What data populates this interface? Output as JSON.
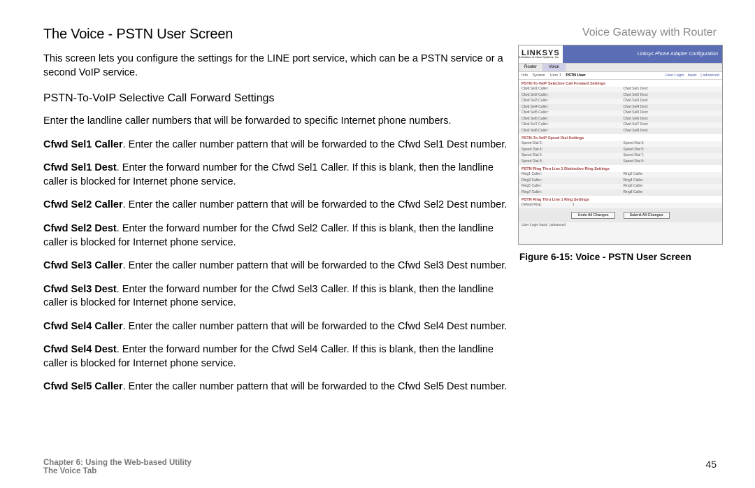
{
  "header": {
    "product": "Voice Gateway with Router"
  },
  "title": "The Voice - PSTN User Screen",
  "intro": "This screen lets you configure the settings for the LINE port service, which can be a PSTN service or a second VoIP service.",
  "subhead": "PSTN-To-VoIP Selective Call Forward Settings",
  "p_intro2": "Enter the landline caller numbers that will be forwarded to specific Internet phone numbers.",
  "paras": [
    {
      "b": "Cfwd Sel1 Caller",
      "t": ". Enter the caller number pattern that will be forwarded to the Cfwd Sel1 Dest number."
    },
    {
      "b": "Cfwd Sel1 Dest",
      "t": ". Enter the forward number for the Cfwd Sel1 Caller. If this is blank, then the landline caller is blocked for Internet phone service."
    },
    {
      "b": "Cfwd Sel2 Caller",
      "t": ". Enter the caller number pattern that will be forwarded to the Cfwd Sel2 Dest number."
    },
    {
      "b": "Cfwd Sel2 Dest",
      "t": ". Enter the forward number for the Cfwd Sel2 Caller. If this is blank, then the landline caller is blocked for Internet phone service."
    },
    {
      "b": "Cfwd Sel3 Caller",
      "t": ". Enter the caller number pattern that will be forwarded to the Cfwd Sel3 Dest number."
    },
    {
      "b": "Cfwd Sel3 Dest",
      "t": ". Enter the forward number for the Cfwd Sel3 Caller. If this is blank, then the landline caller is blocked for Internet phone service."
    },
    {
      "b": "Cfwd Sel4 Caller",
      "t": ". Enter the caller number pattern that will be forwarded to the Cfwd Sel4 Dest number."
    },
    {
      "b": "Cfwd Sel4 Dest",
      "t": ". Enter the forward number for the Cfwd Sel4 Caller. If this is blank, then the landline caller is blocked for Internet phone service."
    },
    {
      "b": "Cfwd Sel5 Caller",
      "t": ". Enter the caller number pattern that will be forwarded to the Cfwd Sel5 Dest number."
    }
  ],
  "figure": {
    "logo": "LINKSYS",
    "logo_sub": "A Division of Cisco Systems, Inc.",
    "banner": "Linksys Phone Adapter Configuration",
    "tabs1": [
      "Router",
      "Voice"
    ],
    "tabs2_left": [
      "Info",
      "System",
      "User 1",
      "PSTN User"
    ],
    "tabs2_right": [
      "User Login",
      "basic",
      "| advanced"
    ],
    "sec1_head": "PSTN-To-VoIP Selective Call Forward Settings",
    "sec1_rows": [
      [
        "Cfwd Sel1 Caller:",
        "",
        "Cfwd Sel1 Dest:",
        ""
      ],
      [
        "Cfwd Sel2 Caller:",
        "",
        "Cfwd Sel2 Dest:",
        ""
      ],
      [
        "Cfwd Sel3 Caller:",
        "",
        "Cfwd Sel3 Dest:",
        ""
      ],
      [
        "Cfwd Sel4 Caller:",
        "",
        "Cfwd Sel4 Dest:",
        ""
      ],
      [
        "Cfwd Sel5 Caller:",
        "",
        "Cfwd Sel5 Dest:",
        ""
      ],
      [
        "Cfwd Sel6 Caller:",
        "",
        "Cfwd Sel6 Dest:",
        ""
      ],
      [
        "Cfwd Sel7 Caller:",
        "",
        "Cfwd Sel7 Dest:",
        ""
      ],
      [
        "Cfwd Sel8 Caller:",
        "",
        "Cfwd Sel8 Dest:",
        ""
      ]
    ],
    "sec2_head": "PSTN-To-VoIP Speed Dial Settings",
    "sec2_rows": [
      [
        "Speed Dial 2:",
        "",
        "Speed Dial 3:",
        ""
      ],
      [
        "Speed Dial 4:",
        "",
        "Speed Dial 5:",
        ""
      ],
      [
        "Speed Dial 6:",
        "",
        "Speed Dial 7:",
        ""
      ],
      [
        "Speed Dial 8:",
        "",
        "Speed Dial 9:",
        ""
      ]
    ],
    "sec3_head": "PSTN Ring Thru Line 1 Distinctive Ring Settings",
    "sec3_rows": [
      [
        "Ring1 Caller:",
        "",
        "Ring2 Caller:",
        ""
      ],
      [
        "Ring3 Caller:",
        "",
        "Ring4 Caller:",
        ""
      ],
      [
        "Ring5 Caller:",
        "",
        "Ring6 Caller:",
        ""
      ],
      [
        "Ring7 Caller:",
        "",
        "Ring8 Caller:",
        ""
      ]
    ],
    "sec4_head": "PSTN Ring Thru Line 1 Ring Settings",
    "sec4_rows": [
      [
        "Default Ring:",
        "1",
        "",
        ""
      ]
    ],
    "btn_undo": "Undo All Changes",
    "btn_submit": "Submit All Changes",
    "footer_links": "User Login    basic   | advanced",
    "caption": "Figure 6-15: Voice - PSTN User Screen"
  },
  "footer": {
    "line1": "Chapter 6: Using the Web-based Utility",
    "line2": "The Voice Tab",
    "page": "45"
  }
}
